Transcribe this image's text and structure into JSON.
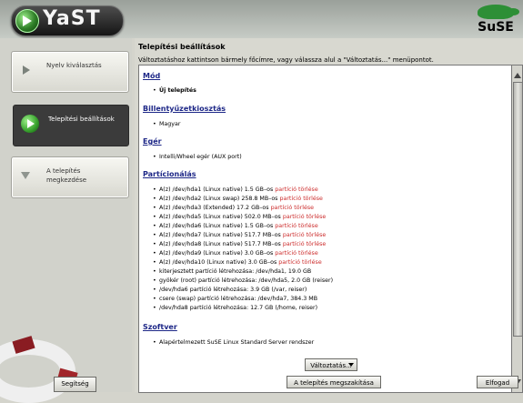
{
  "app": {
    "name": "YaST",
    "brand": "SuSE"
  },
  "sidebar": {
    "steps": [
      {
        "label": "Nyelv kiválasztás"
      },
      {
        "label": "Telepítési beállítások"
      },
      {
        "label": "A telepítés megkezdése"
      }
    ],
    "help_label": "Segítség"
  },
  "main": {
    "title": "Telepítési beállítások",
    "description": "Változtatáshoz kattintson bármely főcímre, vagy válassza alul a \"Változtatás...\" menüpontot.",
    "sections": {
      "mode": {
        "title": "Mód",
        "items": [
          "Új telepítés"
        ]
      },
      "keyboard": {
        "title": "Billentyűzetkiosztás",
        "items": [
          "Magyar"
        ]
      },
      "mouse": {
        "title": "Egér",
        "items": [
          "Intelli/Wheel egér (AUX port)"
        ]
      },
      "partitioning": {
        "title": "Partícionálás",
        "items": [
          {
            "text": "A(z) /dev/hda1 (Linux native) 1.5 GB–os ",
            "red": "partíció törlése"
          },
          {
            "text": "A(z) /dev/hda2 (Linux swap) 258.8 MB–os ",
            "red": "partíció törlése"
          },
          {
            "text": "A(z) /dev/hda3 (Extended) 17.2 GB–os ",
            "red": "partíció törlése"
          },
          {
            "text": "A(z) /dev/hda5 (Linux native) 502.0 MB–os ",
            "red": "partíció törlése"
          },
          {
            "text": "A(z) /dev/hda6 (Linux native) 1.5 GB–os ",
            "red": "partíció törlése"
          },
          {
            "text": "A(z) /dev/hda7 (Linux native) 517.7 MB–os ",
            "red": "partíció törlése"
          },
          {
            "text": "A(z) /dev/hda8 (Linux native) 517.7 MB–os ",
            "red": "partíció törlése"
          },
          {
            "text": "A(z) /dev/hda9 (Linux native) 3.0 GB–os ",
            "red": "partíció törlése"
          },
          {
            "text": "A(z) /dev/hda10 (Linux native) 3.0 GB–os ",
            "red": "partíció törlése"
          },
          {
            "text": "kiterjesztett partíció létrehozása: /dev/hda1, 19.0 GB",
            "red": ""
          },
          {
            "text": "gyökér (root) partíció létrehozása: /dev/hda5, 2.0 GB (reiser)",
            "red": ""
          },
          {
            "text": "/dev/hda6 partíció létrehozása: 3.9 GB (/var, reiser)",
            "red": ""
          },
          {
            "text": "csere (swap) partíció létrehozása: /dev/hda7, 384.3 MB",
            "red": ""
          },
          {
            "text": "/dev/hda8 partíció létrehozása: 12.7 GB (/home, reiser)",
            "red": ""
          }
        ]
      },
      "software": {
        "title": "Szoftver",
        "items": [
          "Alapértelmezett SuSE Linux Standard Server rendszer"
        ]
      }
    },
    "buttons": {
      "change": "Változtatás...",
      "abort": "A telepítés megszakítása",
      "accept": "Elfogad"
    }
  }
}
